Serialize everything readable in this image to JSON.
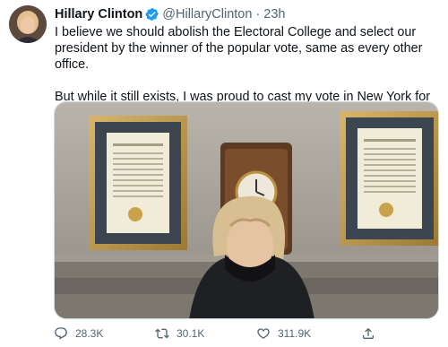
{
  "tweet": {
    "author_name": "Hillary Clinton",
    "handle": "@HillaryClinton",
    "separator": "·",
    "time": "23h",
    "paragraphs": [
      "I believe we should abolish the Electoral College and select our president by the winner of the popular vote, same as every other office.",
      "But while it still exists, I was proud to cast my vote in New York for Joe Biden and Kamala Harris."
    ],
    "replies": "28.3K",
    "retweets": "30.1K",
    "likes": "311.9K"
  },
  "icons": {
    "verified": "verified-badge-icon",
    "reply": "reply-icon",
    "retweet": "retweet-icon",
    "like": "heart-icon",
    "share": "share-icon"
  },
  "colors": {
    "accent": "#1d9bf0",
    "text": "#0f1419",
    "muted": "#536471"
  }
}
